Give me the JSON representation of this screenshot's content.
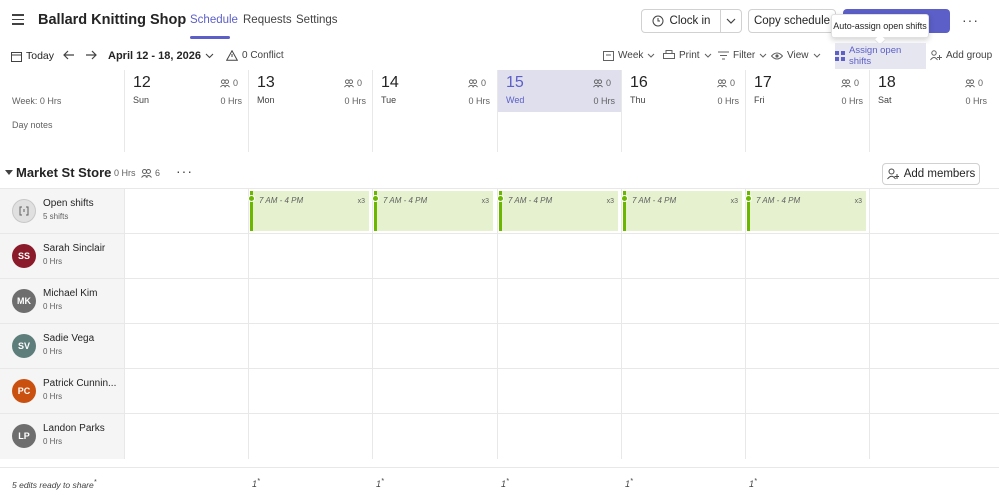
{
  "app": {
    "title": "Ballard Knitting Shop"
  },
  "tabs": [
    {
      "label": "Schedule",
      "active": true
    },
    {
      "label": "Requests",
      "active": false
    },
    {
      "label": "Settings",
      "active": false
    }
  ],
  "actions": {
    "clock_in": "Clock in",
    "copy_schedule": "Copy schedule",
    "tooltip": "Auto-assign open shifts"
  },
  "toolbar": {
    "today": "Today",
    "date_range": "April 12 - 18, 2026",
    "conflicts": "0 Conflict",
    "week": "Week",
    "print": "Print",
    "filter": "Filter",
    "view": "View",
    "assign_open_shifts": "Assign open shifts",
    "add_group": "Add group"
  },
  "week": {
    "hrs_label": "Week: 0 Hrs",
    "day_notes": "Day notes",
    "days": [
      {
        "num": "12",
        "name": "Sun",
        "count": "0",
        "hrs": "0 Hrs",
        "today": false
      },
      {
        "num": "13",
        "name": "Mon",
        "count": "0",
        "hrs": "0 Hrs",
        "today": false
      },
      {
        "num": "14",
        "name": "Tue",
        "count": "0",
        "hrs": "0 Hrs",
        "today": false
      },
      {
        "num": "15",
        "name": "Wed",
        "count": "0",
        "hrs": "0 Hrs",
        "today": true
      },
      {
        "num": "16",
        "name": "Thu",
        "count": "0",
        "hrs": "0 Hrs",
        "today": false
      },
      {
        "num": "17",
        "name": "Fri",
        "count": "0",
        "hrs": "0 Hrs",
        "today": false
      },
      {
        "num": "18",
        "name": "Sat",
        "count": "0",
        "hrs": "0 Hrs",
        "today": false
      }
    ]
  },
  "group": {
    "name": "Market St Store",
    "hrs": "0 Hrs",
    "members": "6",
    "add_members": "Add members"
  },
  "open_shifts": {
    "label": "Open shifts",
    "count_label": "5 shifts",
    "shift_time": "7 AM - 4 PM",
    "shift_count": "x3"
  },
  "people": [
    {
      "initials": "SS",
      "name": "Sarah Sinclair",
      "hrs": "0 Hrs",
      "color": "#8b1a2b"
    },
    {
      "initials": "MK",
      "name": "Michael Kim",
      "hrs": "0 Hrs",
      "color": "#6e6e6e"
    },
    {
      "initials": "SV",
      "name": "Sadie Vega",
      "hrs": "0 Hrs",
      "color": "#5e7e7b"
    },
    {
      "initials": "PC",
      "name": "Patrick Cunnin...",
      "hrs": "0 Hrs",
      "color": "#ca5010"
    },
    {
      "initials": "LP",
      "name": "Landon Parks",
      "hrs": "0 Hrs",
      "color": "#6e6e6e"
    }
  ],
  "footer": {
    "edits": "5 edits ready to share",
    "day_mark": "1"
  },
  "colors": {
    "accent": "#5b5fc7",
    "shift_bg": "#e6f2cf",
    "shift_bar": "#6bb700"
  }
}
